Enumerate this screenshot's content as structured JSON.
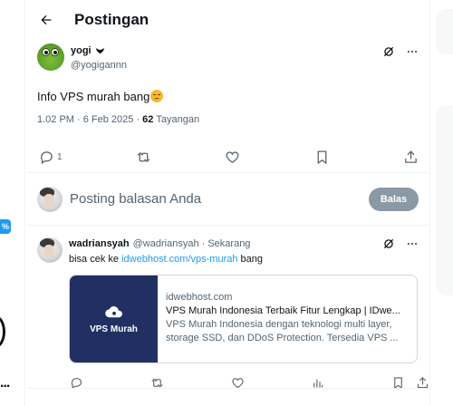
{
  "header": {
    "title": "Postingan"
  },
  "post": {
    "author_name": "yogi",
    "author_handle": "@yogigannn",
    "text": "Info VPS murah bang",
    "time": "1.02 PM · 6 Feb 2025 ·",
    "views_count": "62",
    "views_label": "Tayangan",
    "reply_count": "1"
  },
  "compose": {
    "placeholder": "Posting balasan Anda",
    "button_label": "Balas"
  },
  "reply": {
    "author_name": "wadriansyah",
    "author_handle": "@wadriansyah · Sekarang",
    "text_prefix": "bisa cek ke",
    "link_text": "idwebhost.com/vps-murah",
    "text_suffix": "bang",
    "card": {
      "thumb_label": "VPS Murah",
      "domain": "idwebhost.com",
      "title": "VPS Murah Indonesia Terbaik Fitur Lengkap | IDwe...",
      "description": "VPS Murah Indonesia dengan teknologi multi layer, storage SSD, dan DDoS Protection. Tersedia VPS ..."
    }
  },
  "left_rail": {
    "badge": "%",
    "more": "..."
  },
  "colors": {
    "accent": "#1d9bf0",
    "muted": "#536471",
    "button_disabled": "#8b98a5",
    "card_thumb": "#222f63"
  },
  "icons": [
    "back-arrow-icon",
    "verified-icon",
    "grok-icon",
    "more-icon",
    "reply-icon",
    "retweet-icon",
    "like-icon",
    "bookmark-icon",
    "share-icon",
    "views-icon",
    "cloud-icon"
  ]
}
